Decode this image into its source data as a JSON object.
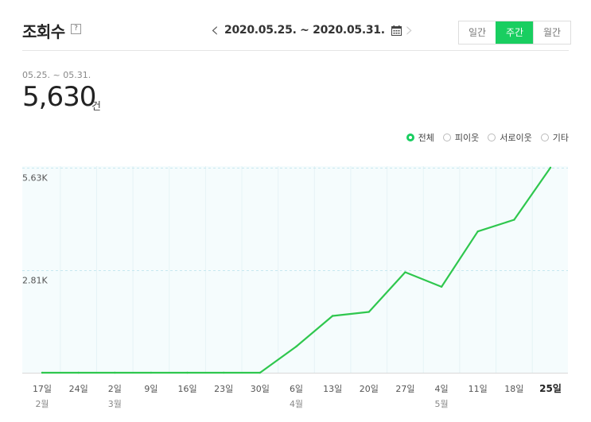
{
  "header": {
    "title": "조회수",
    "help": "?",
    "date_range": "2020.05.25. ~ 2020.05.31.",
    "prev_icon": "chevron-left-icon",
    "next_icon": "chevron-right-icon",
    "calendar_icon": "calendar-icon"
  },
  "period_tabs": [
    {
      "label": "일간",
      "active": false
    },
    {
      "label": "주간",
      "active": true
    },
    {
      "label": "월간",
      "active": false
    }
  ],
  "summary": {
    "period": "05.25. ~ 05.31.",
    "total": "5,630",
    "unit": "건"
  },
  "legend": [
    {
      "label": "전체",
      "checked": true
    },
    {
      "label": "피이웃",
      "checked": false
    },
    {
      "label": "서로이웃",
      "checked": false
    },
    {
      "label": "기타",
      "checked": false
    }
  ],
  "colors": {
    "accent": "#19ce60",
    "line": "#2fc74e",
    "plot_bg": "#f5fcfd",
    "grid": "#c7e8f0"
  },
  "chart_data": {
    "type": "line",
    "x": [
      "17일",
      "24일",
      "2일",
      "9일",
      "16일",
      "23일",
      "30일",
      "6일",
      "13일",
      "20일",
      "27일",
      "4일",
      "11일",
      "18일",
      "25일"
    ],
    "month_labels": [
      "2월",
      "",
      "3월",
      "",
      "",
      "",
      "",
      "4월",
      "",
      "",
      "",
      "5월",
      "",
      "",
      ""
    ],
    "highlight_index": 14,
    "series": [
      {
        "values": [
          0,
          0,
          0,
          0,
          0,
          0,
          0,
          720,
          1560,
          1670,
          2760,
          2360,
          3880,
          4200,
          5630
        ]
      }
    ],
    "yticks": [
      {
        "value": 5630,
        "label": "5.63K"
      },
      {
        "value": 2810,
        "label": "2.81K"
      }
    ],
    "ylim": [
      0,
      5630
    ],
    "grid": true
  }
}
